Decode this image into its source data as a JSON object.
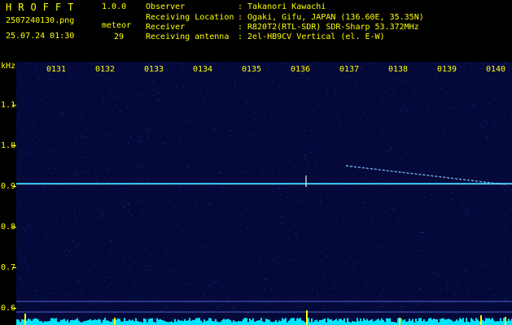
{
  "header": {
    "app_title": "HROFFT",
    "app_version": "1.0.0",
    "filename": "2507240130.png",
    "datetime": "25.07.24 01:30",
    "meteor_label": "meteor",
    "meteor_count": "29",
    "info": [
      {
        "key": "Observer",
        "value": "Takanori Kawachi"
      },
      {
        "key": "Receiving Location",
        "value": "Ogaki, Gifu, JAPAN (136.60E, 35.35N)"
      },
      {
        "key": "Receiver",
        "value": "R820T2(RTL-SDR) SDR-Sharp 53.372MHz"
      },
      {
        "key": "Receiving antenna",
        "value": "2el-HB9CV Vertical (el. E-W)"
      }
    ],
    "separator": ":"
  },
  "axis": {
    "y_unit": "kHz",
    "y_ticks": [
      "1.1",
      "1.0",
      "0.9",
      "0.8",
      "0.7",
      "0.6"
    ],
    "x_ticks": [
      "0131",
      "0132",
      "0133",
      "0134",
      "0135",
      "0136",
      "0137",
      "0138",
      "0139",
      "0140"
    ]
  },
  "colors": {
    "background": "#000000",
    "label": "#ffff00",
    "spectrogram_bg": "#04093a",
    "carrier_line": "#33ccff",
    "meteor_trail": "#88ccff",
    "level_fill": "#00e5ff",
    "level_spike": "#ffff00"
  }
}
